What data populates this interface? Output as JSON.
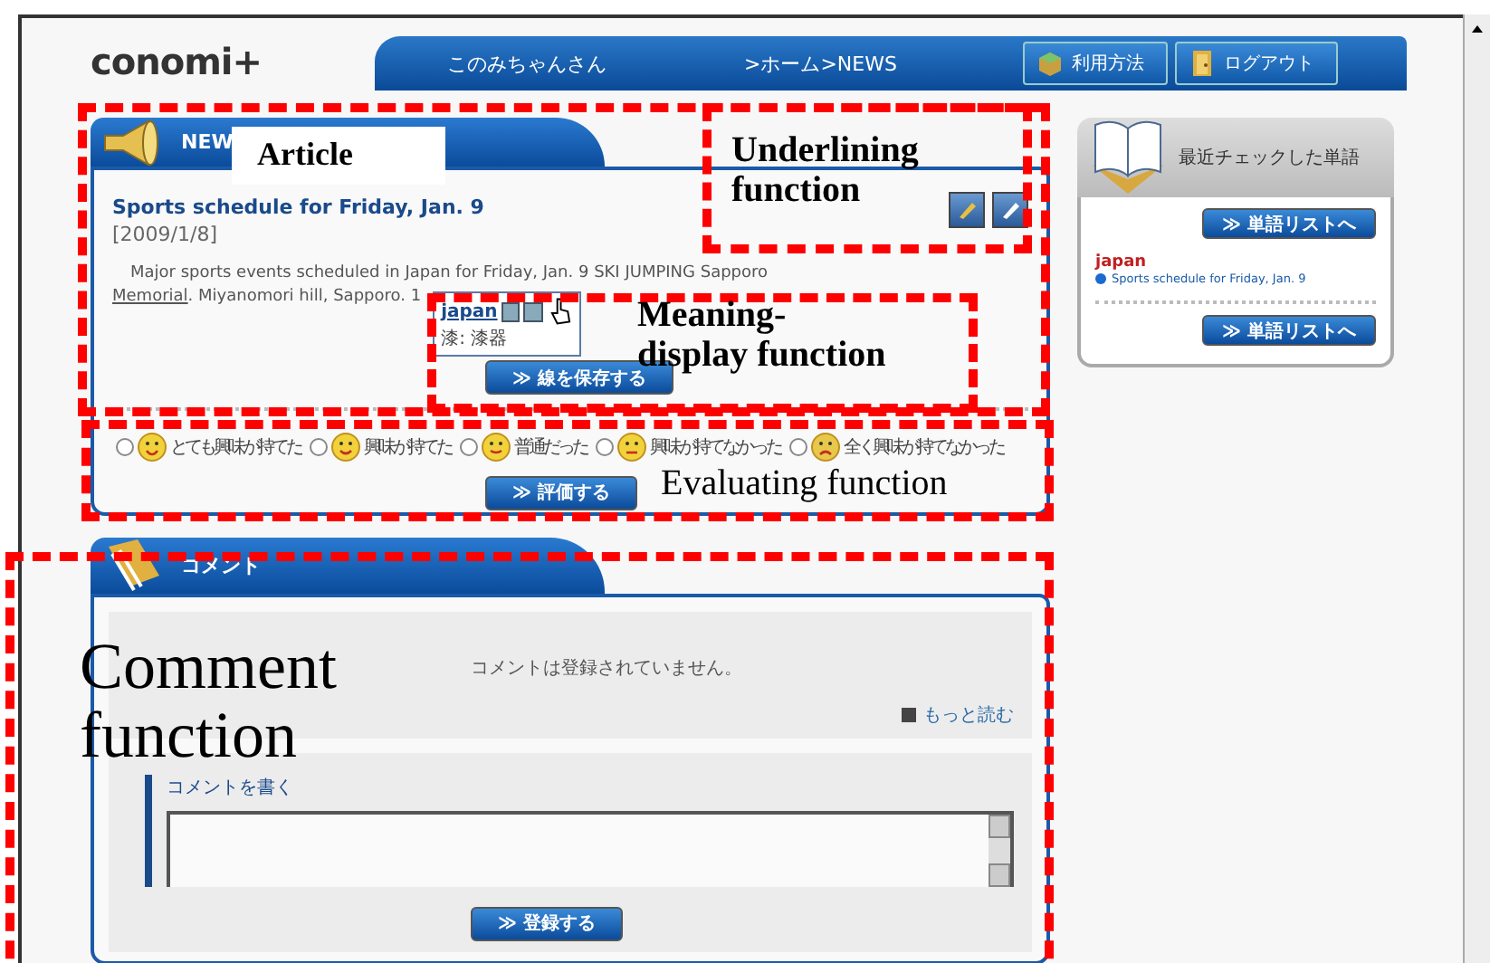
{
  "header": {
    "logo": "conomi+",
    "user": "このみちゃんさん",
    "breadcrumb": ">ホーム>NEWS",
    "buttons": [
      {
        "label": "利用方法",
        "kind": "box"
      },
      {
        "label": "ログアウト",
        "kind": "door"
      }
    ]
  },
  "article": {
    "tab": "NEW",
    "title": "Sports schedule for Friday, Jan. 9",
    "date": "[2009/1/8]",
    "line_1": "Major sports events scheduled in Japan for Friday, Jan. 9 SKI JUMPING Sapporo",
    "line_2": [
      {
        "text": "Memorial",
        "underlined": true
      },
      {
        "text": ". Miyanomori hill, Sapporo. 1",
        "underlined": false
      }
    ],
    "popup": {
      "word": "japan",
      "meaning": "漆: 漆器"
    },
    "save_button": "≫ 線を保存する",
    "ratings": [
      {
        "label": "とても興味が持てた",
        "kind": "love",
        "selected": false
      },
      {
        "label": "興味が持てた",
        "kind": "happy",
        "selected": false
      },
      {
        "label": "普通だった",
        "kind": "smile",
        "selected": false
      },
      {
        "label": "興味が持てなかった",
        "kind": "neutral",
        "selected": false
      },
      {
        "label": "全く興味が持てなかった",
        "kind": "sad",
        "selected": false
      }
    ],
    "rate_button": "≫ 評価する"
  },
  "recent_words": {
    "title": "最近チェックした単語",
    "buttons": [
      "≫ 単語リストへ",
      "≫ 単語リストへ"
    ],
    "word": "japan",
    "source": "Sports schedule for Friday, Jan. 9"
  },
  "comments": {
    "tab": "コメント",
    "message": "コメントは登録されていません。",
    "more_link": "もっと読む",
    "write_heading": "コメントを書く",
    "submit_button": "≫ 登録する"
  },
  "annotations": [
    {
      "label": "Article",
      "kind": "boxed"
    },
    {
      "label": "Underlining function",
      "kind": "bold"
    },
    {
      "label": "Meaning-display function",
      "kind": "bold"
    },
    {
      "label": "Evaluating function",
      "kind": "plain"
    },
    {
      "label": "Comment function",
      "kind": "large"
    }
  ]
}
